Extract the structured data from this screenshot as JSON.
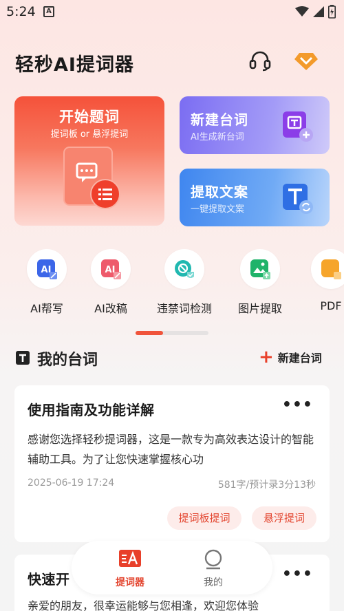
{
  "status_bar": {
    "time": "5:24",
    "a_badge": "A"
  },
  "header": {
    "title": "轻秒AI提词器",
    "support_icon": "headset-icon",
    "vip_icon": "diamond-icon"
  },
  "cards": {
    "start": {
      "title": "开始题词",
      "subtitle": "提词板 or 悬浮提词",
      "color": "#f5523a"
    },
    "new_script": {
      "title": "新建台词",
      "subtitle": "AI生成新台词",
      "color": "#7b6df2"
    },
    "extract": {
      "title": "提取文案",
      "subtitle": "一键提取文案",
      "color": "#3f86ef"
    }
  },
  "tools": [
    {
      "label": "AI帮写",
      "icon": "ai-write-icon"
    },
    {
      "label": "AI改稿",
      "icon": "ai-edit-icon"
    },
    {
      "label": "违禁词检测",
      "icon": "forbidden-word-check-icon"
    },
    {
      "label": "图片提取",
      "icon": "image-extract-icon"
    },
    {
      "label": "PDF",
      "icon": "pdf-extract-icon"
    }
  ],
  "my_scripts": {
    "title": "我的台词",
    "new_label": "新建台词",
    "items": [
      {
        "title": "使用指南及功能详解",
        "preview": "感谢您选择轻秒提词器，这是一款专为高效表达设计的智能辅助工具。为了让您快速掌握核心功",
        "date": "2025-06-19 17:24",
        "stats": "581字/预计录3分13秒",
        "tag1": "提词板提词",
        "tag2": "悬浮提词"
      },
      {
        "title": "快速开",
        "preview": "亲爱的朋友，很幸运能够与您相逢，欢迎您体验"
      }
    ]
  },
  "bottom_nav": [
    {
      "label": "提词器",
      "active": true
    },
    {
      "label": "我的",
      "active": false
    }
  ],
  "colors": {
    "accent": "#e3452f",
    "tag_bg": "#fdecea"
  }
}
